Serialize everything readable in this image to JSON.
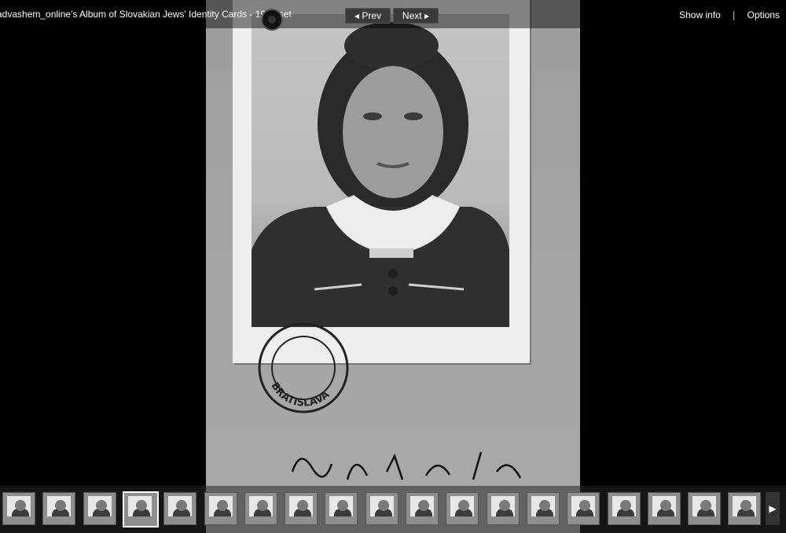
{
  "header": {
    "album_title": "advashem_online's Album of Slovakian Jews' Identity Cards - 1941 set",
    "prev_label": "Prev",
    "next_label": "Next",
    "show_info_label": "Show info",
    "separator": "|",
    "options_label": "Options"
  },
  "photo": {
    "stamp_text_bottom": "BRATISLAVA"
  },
  "filmstrip": {
    "thumbnail_count": 19,
    "selected_index": 3
  },
  "colors": {
    "background": "#000000",
    "button_bg": "#3a3a3a",
    "text": "#ffffff"
  }
}
